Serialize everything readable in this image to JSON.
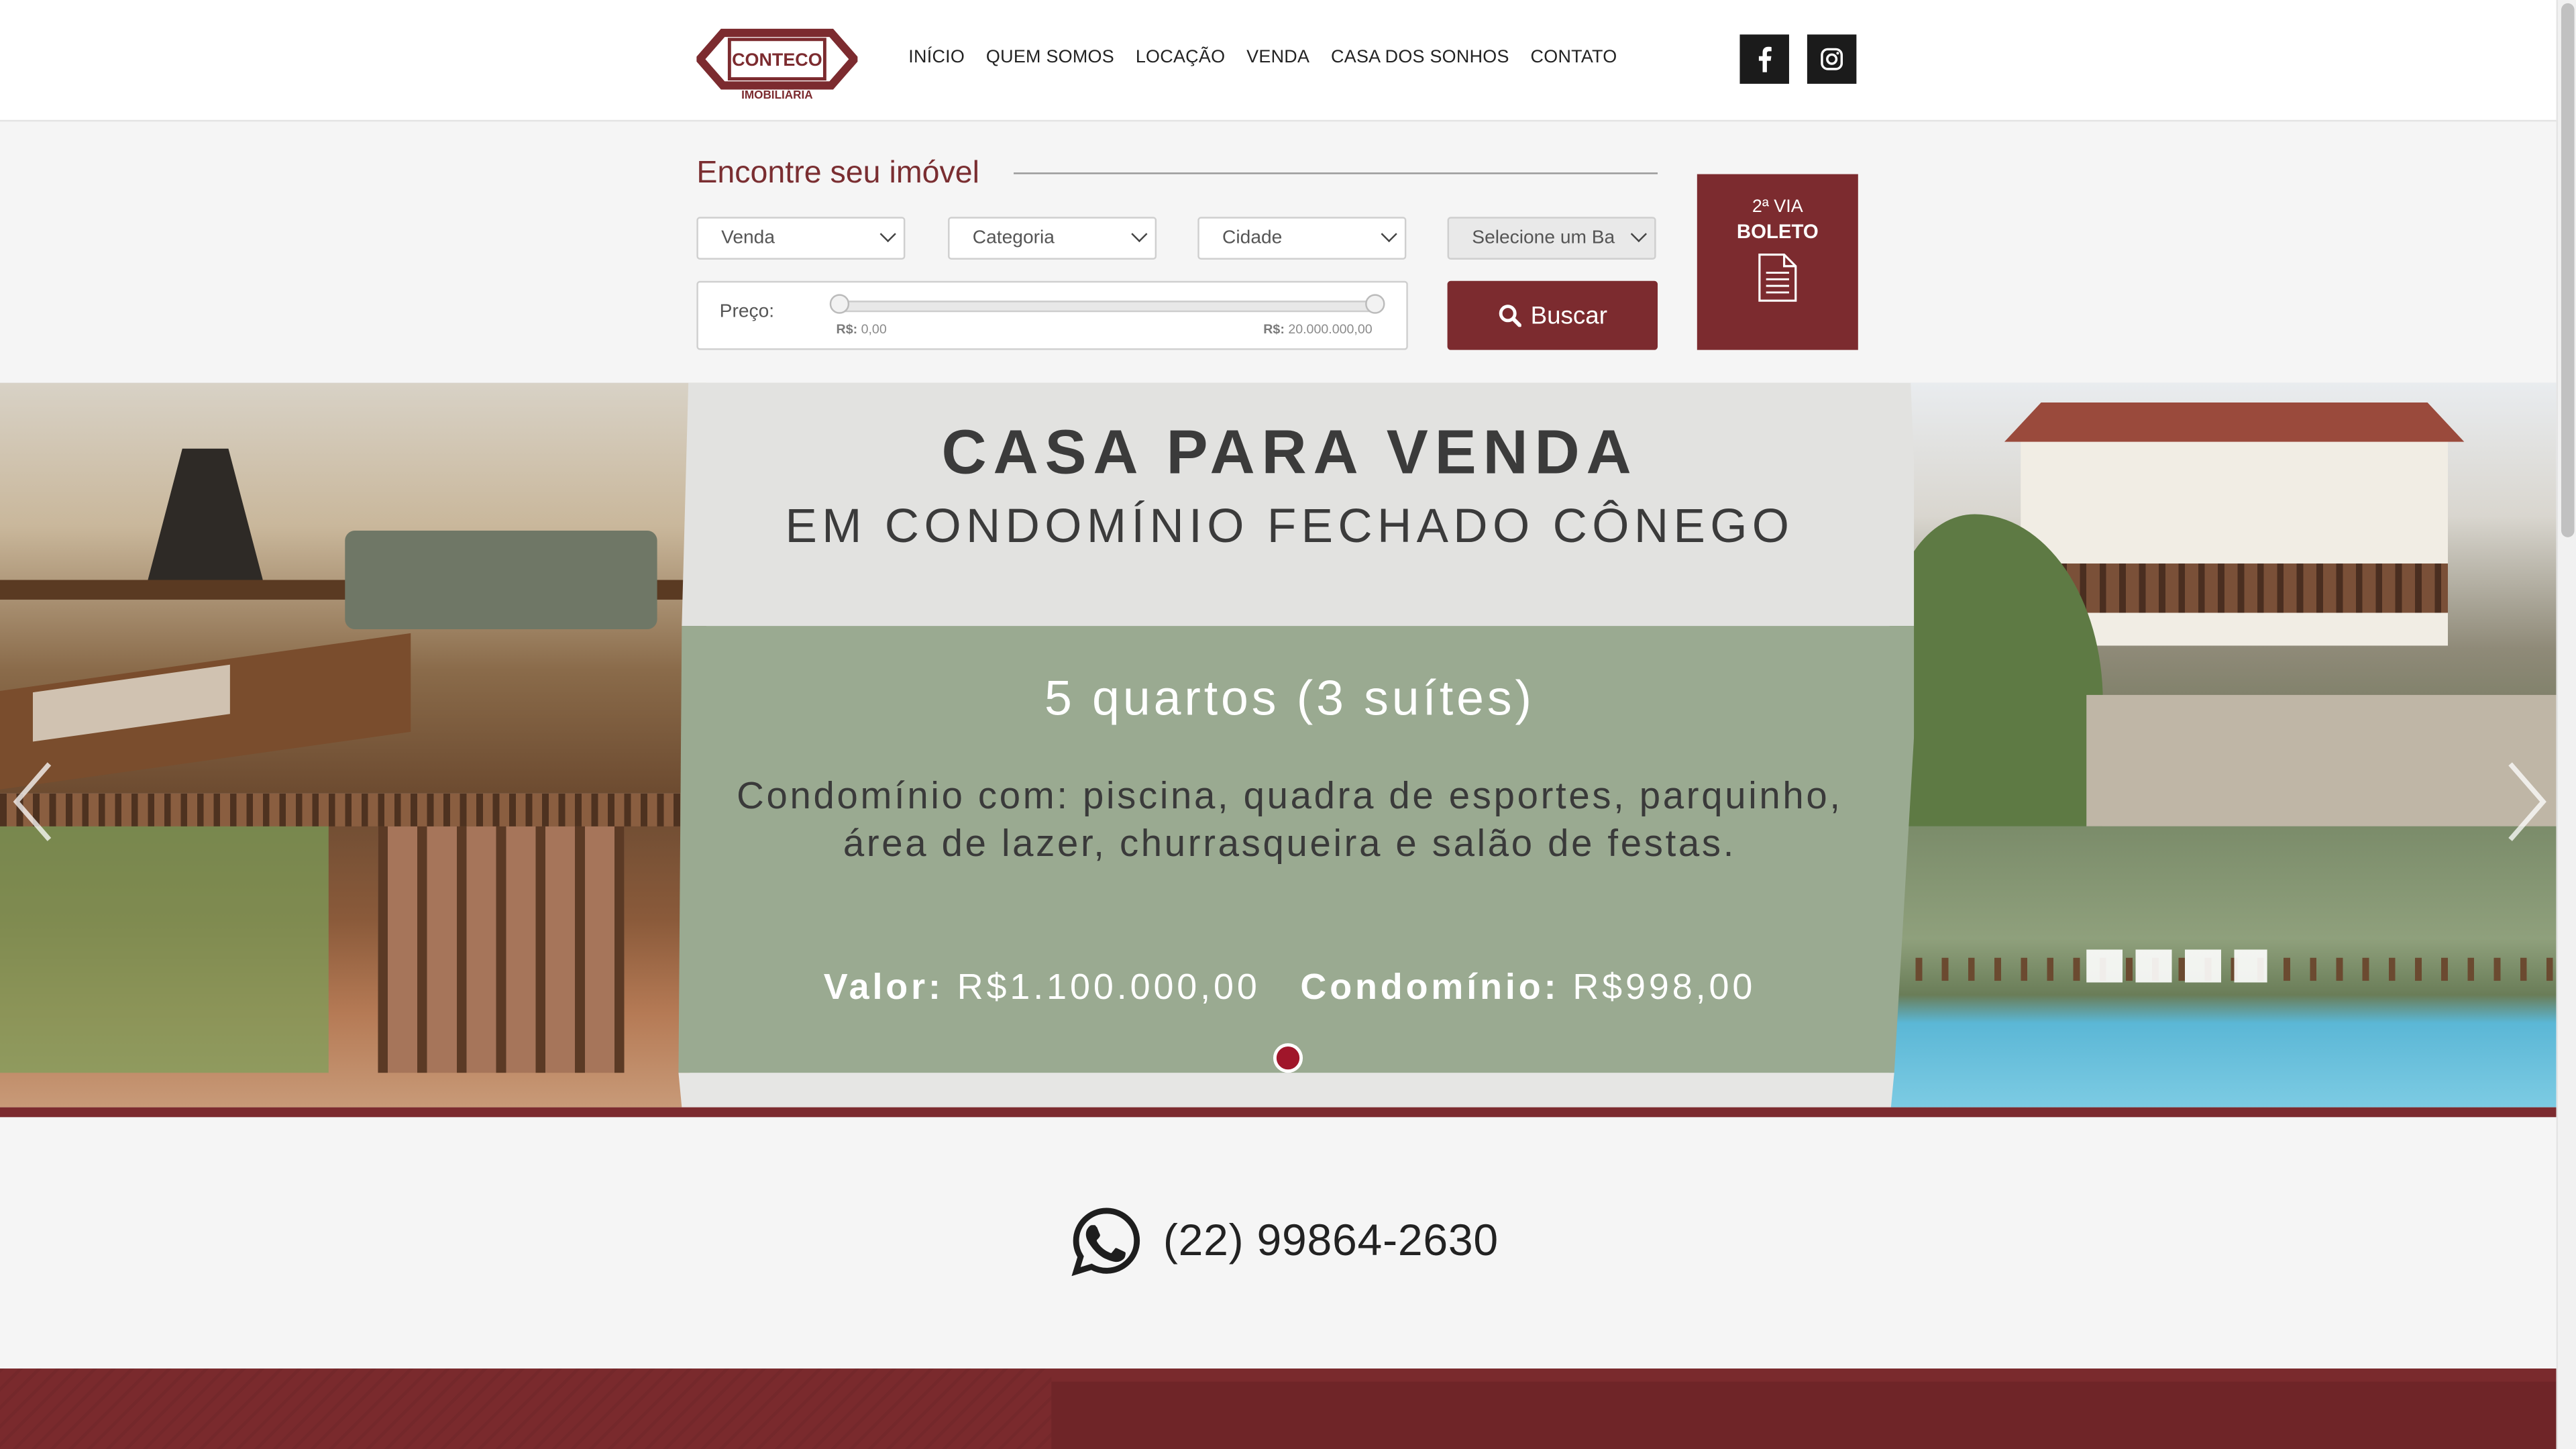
{
  "header": {
    "logo_text": "CONTECO",
    "logo_sub": "IMOBILIÁRIA",
    "nav": [
      "INÍCIO",
      "QUEM SOMOS",
      "LOCAÇÃO",
      "VENDA",
      "CASA DOS SONHOS",
      "CONTATO"
    ],
    "social": [
      "facebook-icon",
      "instagram-icon"
    ]
  },
  "search": {
    "title": "Encontre seu imóvel",
    "selects": [
      "Venda",
      "Categoria",
      "Cidade",
      "Selecione um Ba"
    ],
    "price_label": "Preço:",
    "price_min": "0,00",
    "price_max": "20.000.000,00",
    "currency": "R$:",
    "button": "Buscar"
  },
  "boleto": {
    "top": "2ª VIA",
    "main": "BOLETO"
  },
  "banner": {
    "title_1": "CASA PARA VENDA",
    "title_2": "EM CONDOMÍNIO FECHADO CÔNEGO",
    "quartos": "5 quartos (3 suítes)",
    "desc": "Condomínio com: piscina, quadra de esportes, parquinho, área de lazer, churrasqueira e salão de festas.",
    "valor_label": "Valor:",
    "valor": "R$1.100.000,00",
    "condominio_label": "Condomínio:",
    "condominio": "R$998,00"
  },
  "contact": {
    "whatsapp": "(22) 99864-2630"
  },
  "colors": {
    "brand": "#7c2b2f",
    "panel_green": "#9aaa91",
    "panel_top": "#e2e2e0"
  }
}
